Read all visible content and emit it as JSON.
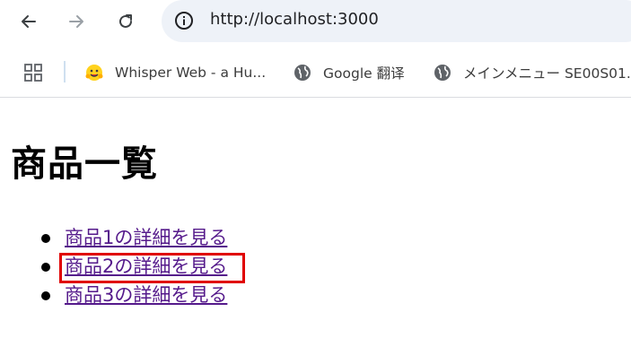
{
  "browser": {
    "address_bar": {
      "url": "http://localhost:3000"
    },
    "bookmarks": [
      {
        "label": "Whisper Web - a Hu...",
        "icon": "hugging-face-icon"
      },
      {
        "label": "Google 翻译",
        "icon": "globe-icon"
      },
      {
        "label": "メインメニュー SE00S01...",
        "icon": "globe-icon"
      }
    ]
  },
  "page": {
    "title": "商品一覧",
    "products": [
      {
        "link_text": "商品1の詳細を見る"
      },
      {
        "link_text": "商品2の詳細を見る",
        "highlighted": true
      },
      {
        "link_text": "商品3の詳細を見る"
      }
    ]
  },
  "colors": {
    "visited_link": "#551a8b",
    "highlight_border": "#e00000",
    "omnibox_bg": "#eef2f8"
  }
}
